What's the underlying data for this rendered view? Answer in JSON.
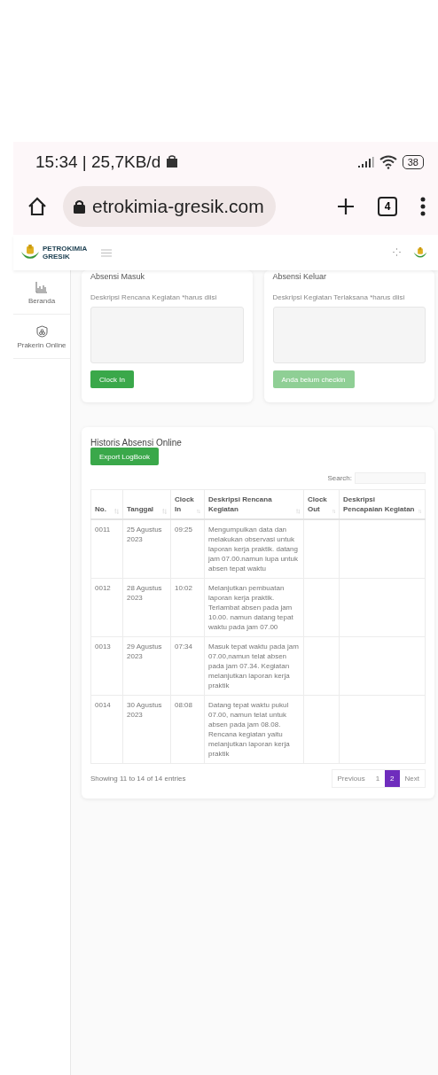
{
  "status_bar": {
    "time": "15:34 | 25,7KB/d",
    "battery": "38"
  },
  "browser": {
    "url": "etrokimia-gresik.com",
    "tab_count": "4"
  },
  "header": {
    "logo_line1": "PETROKIMIA",
    "logo_line2": "GRESIK"
  },
  "sidebar": {
    "items": [
      {
        "label": "Beranda",
        "kind": "chart"
      },
      {
        "label": "Prakerin Online",
        "kind": "shield"
      }
    ]
  },
  "forms": [
    {
      "title": "Absensi Masuk",
      "field_label": "Deskripsi Rencana Kegiatan *harus diisi",
      "button": {
        "label": "Clock In",
        "disabled": false
      }
    },
    {
      "title": "Absensi Keluar",
      "field_label": "Deskripsi Kegiatan Terlaksana *harus diisi",
      "button": {
        "label": "Anda belum checkin",
        "disabled": true
      }
    }
  ],
  "history": {
    "title": "Historis Absensi Online",
    "export_button": "Export LogBook",
    "search_label": "Search:",
    "columns": [
      {
        "label": "No."
      },
      {
        "label": "Tanggal"
      },
      {
        "label": "Clock In"
      },
      {
        "label": "Deskripsi Rencana Kegiatan"
      },
      {
        "label": "Clock Out"
      },
      {
        "label": "Deskripsi Pencapaian Kegiatan"
      }
    ],
    "rows": [
      {
        "no": "0011",
        "date": "25 Agustus 2023",
        "clock_in": "09:25",
        "plan": "Mengumpulkan data dan melakukan observasi untuk laporan kerja praktik. datang jam 07.00.namun lupa untuk absen tepat waktu"
      },
      {
        "no": "0012",
        "date": "28 Agustus 2023",
        "clock_in": "10:02",
        "plan": "Melanjutkan pembuatan laporan kerja praktik. Terlambat absen pada jam 10.00. namun datang tepat waktu pada jam 07.00"
      },
      {
        "no": "0013",
        "date": "29 Agustus 2023",
        "clock_in": "07:34",
        "plan": "Masuk tepat waktu pada jam 07.00,namun telat absen pada jam 07.34. Kegiatan melanjutkan laporan kerja praktik"
      },
      {
        "no": "0014",
        "date": "30 Agustus 2023",
        "clock_in": "08:08",
        "plan": "Datang tepat waktu pukul 07.00, namun telat untuk absen pada jam 08.08. Rencana kegiatan yaitu melanjutkan laporan kerja praktik"
      }
    ],
    "info": "Showing 11 to 14 of 14 entries",
    "pagination": [
      {
        "label": "Previous",
        "selected": false
      },
      {
        "label": "1",
        "selected": false
      },
      {
        "label": "2",
        "selected": true
      },
      {
        "label": "Next",
        "selected": false
      }
    ]
  }
}
